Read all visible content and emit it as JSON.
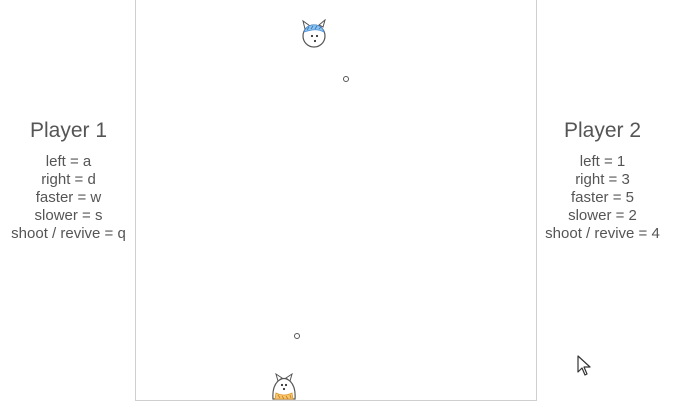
{
  "players": [
    {
      "title": "Player 1",
      "controls": [
        "left = a",
        "right = d",
        "faster = w",
        "slower = s",
        "shoot / revive = q"
      ],
      "color": "#f0a030"
    },
    {
      "title": "Player 2",
      "controls": [
        "left = 1",
        "right = 3",
        "faster = 5",
        "slower = 2",
        "shoot / revive = 4"
      ],
      "color": "#4a90d9"
    }
  ],
  "arena": {
    "border_color": "#cfcfcf",
    "sprites": [
      "player1-cat-icon",
      "player2-cat-icon"
    ],
    "bullets": 2
  },
  "icons": {
    "cursor": "mouse-pointer-icon"
  }
}
